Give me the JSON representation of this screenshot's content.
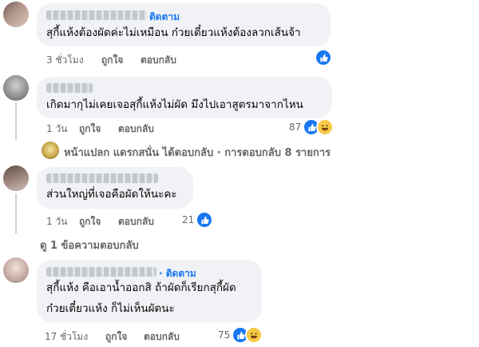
{
  "comments": [
    {
      "follow_label": "ติดตาม",
      "text_lines": [
        "สุกี้แห้งต้องผัดค่ะไม่เหมือน ก๋วยเตี๋ยวแห้งต้องลวกเส้นจ้า"
      ],
      "time": "3 ชั่วโมง",
      "like_label": "ถูกใจ",
      "reply_label": "ตอบกลับ",
      "reaction_count": ""
    },
    {
      "text_lines": [
        "เกิดมากุไม่เคยเจอสุกี้แห้งไม่ผัด มึงไปเอาสูตรมาจากไหน"
      ],
      "time": "1 วัน",
      "like_label": "ถูกใจ",
      "reply_label": "ตอบกลับ",
      "reaction_count": "87",
      "replies_summary": "หน้าแปลก แดรกสนั่น ได้ตอบกลับ · การตอบกลับ 8 รายการ"
    },
    {
      "text_lines": [
        "ส่วนใหญ่ที่เจอคือผัดให้นะคะ"
      ],
      "time": "1 วัน",
      "like_label": "ถูกใจ",
      "reply_label": "ตอบกลับ",
      "reaction_count": "21",
      "replies_summary": "ดู 1 ข้อความตอบกลับ"
    },
    {
      "follow_label": "· ติดตาม",
      "text_lines": [
        "สุกี้แห้ง คือเอาน้ำออกสิ ถ้าผัดก็เรียกสุกี้ผัด",
        "ก๋วยเตี๋ยวแห้ง ก็ไม่เห็นผัดนะ"
      ],
      "time": "17 ชั่วโมง",
      "like_label": "ถูกใจ",
      "reply_label": "ตอบกลับ",
      "reaction_count": "75"
    }
  ],
  "icons": {
    "like": "like-icon",
    "haha": "haha-icon"
  },
  "colors": {
    "bubble": "#f0f2f5",
    "link": "#1877f2",
    "meta": "#65676b",
    "text": "#050505"
  }
}
